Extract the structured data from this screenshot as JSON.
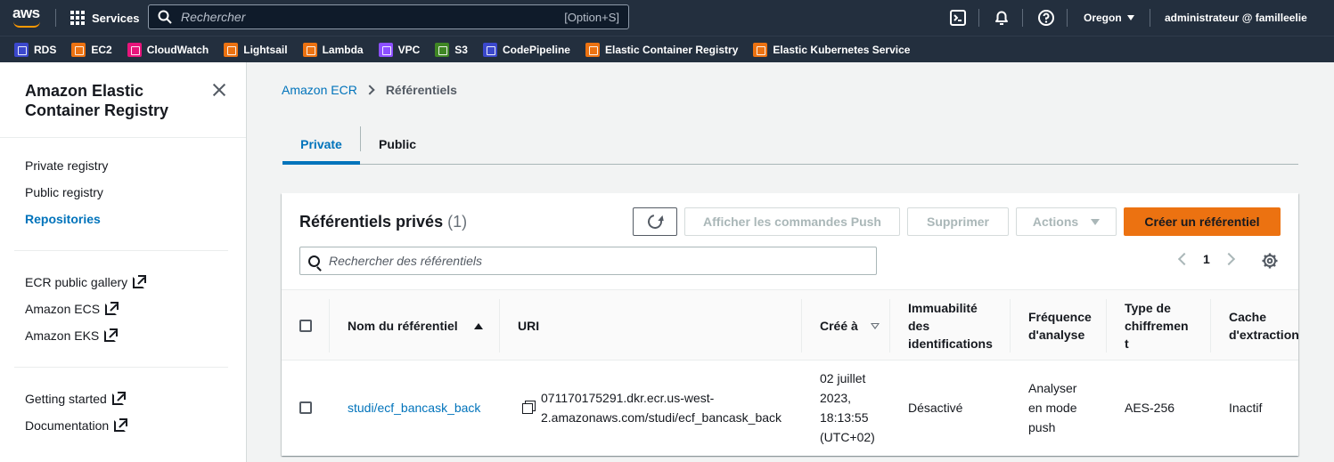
{
  "topnav": {
    "logo": "aws",
    "services_label": "Services",
    "search_placeholder": "Rechercher",
    "search_shortcut": "[Option+S]",
    "region": "Oregon",
    "account": "administrateur @ familleelie"
  },
  "favorites": [
    {
      "label": "RDS",
      "color": "#3b48cc"
    },
    {
      "label": "EC2",
      "color": "#ec7211"
    },
    {
      "label": "CloudWatch",
      "color": "#e7157b"
    },
    {
      "label": "Lightsail",
      "color": "#ec7211"
    },
    {
      "label": "Lambda",
      "color": "#ec7211"
    },
    {
      "label": "VPC",
      "color": "#8c4fff"
    },
    {
      "label": "S3",
      "color": "#3f8624"
    },
    {
      "label": "CodePipeline",
      "color": "#3b48cc"
    },
    {
      "label": "Elastic Container Registry",
      "color": "#ec7211"
    },
    {
      "label": "Elastic Kubernetes Service",
      "color": "#ec7211"
    }
  ],
  "sidebar": {
    "title": "Amazon Elastic Container Registry",
    "links": [
      "Private registry",
      "Public registry",
      "Repositories"
    ],
    "external_links": [
      "ECR public gallery",
      "Amazon ECS",
      "Amazon EKS"
    ],
    "help_links": [
      "Getting started",
      "Documentation"
    ]
  },
  "breadcrumb": {
    "root": "Amazon ECR",
    "current": "Référentiels"
  },
  "tabs": [
    "Private",
    "Public"
  ],
  "card": {
    "title": "Référentiels privés",
    "count": "(1)",
    "buttons": {
      "push_commands": "Afficher les commandes Push",
      "delete": "Supprimer",
      "actions": "Actions",
      "create": "Créer un référentiel"
    },
    "search_placeholder": "Rechercher des référentiels",
    "page": "1"
  },
  "table": {
    "headers": {
      "name": "Nom du référentiel",
      "uri": "URI",
      "created": "Créé à",
      "immutability_1": "Immuabilité",
      "immutability_2": "des",
      "immutability_3": "identifications",
      "scan_1": "Fréquence",
      "scan_2": "d'analyse",
      "enc_1": "Type de",
      "enc_2": "chiffremen",
      "enc_3": "t",
      "cache_1": "Cache",
      "cache_2": "d'extraction"
    },
    "rows": [
      {
        "name": "studi/ecf_bancask_back",
        "uri_1": "071170175291.dkr.ecr.us-west-",
        "uri_2": "2.amazonaws.com/studi/ecf_bancask_back",
        "created_1": "02 juillet",
        "created_2": "2023,",
        "created_3": "18:13:55",
        "created_4": "(UTC+02)",
        "immutability": "Désactivé",
        "scan_1": "Analyser",
        "scan_2": "en mode",
        "scan_3": "push",
        "encryption": "AES-256",
        "cache": "Inactif"
      }
    ]
  }
}
